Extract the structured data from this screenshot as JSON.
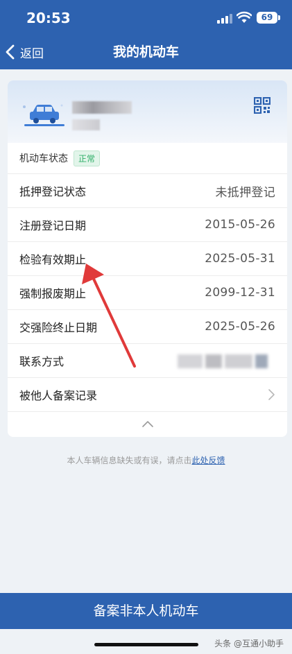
{
  "status_bar": {
    "time": "20:53",
    "battery": "69"
  },
  "header": {
    "back_label": "返回",
    "title": "我的机动车"
  },
  "vehicle": {
    "status_label": "机动车状态",
    "status_badge": "正常"
  },
  "rows": [
    {
      "label": "抵押登记状态",
      "value": "未抵押登记"
    },
    {
      "label": "注册登记日期",
      "value": "2015-05-26"
    },
    {
      "label": "检验有效期止",
      "value": "2025-05-31"
    },
    {
      "label": "强制报废期止",
      "value": "2099-12-31"
    },
    {
      "label": "交强险终止日期",
      "value": "2025-05-26"
    },
    {
      "label": "联系方式",
      "value": ""
    },
    {
      "label": "被他人备案记录",
      "value": ""
    }
  ],
  "feedback": {
    "text": "本人车辆信息缺失或有误，请点击",
    "link": "此处反馈"
  },
  "bottom_button": "备案非本人机动车",
  "watermark": "头条 @互通小助手",
  "colors": {
    "primary": "#2d62b0",
    "status_ok": "#2fae68",
    "annotation_arrow": "#e03a3a"
  }
}
